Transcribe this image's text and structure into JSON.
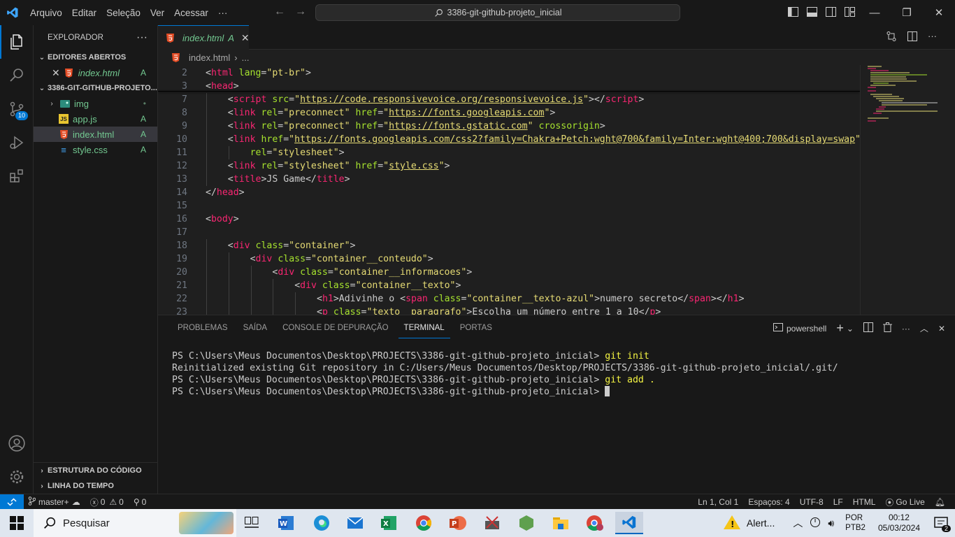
{
  "titlebar": {
    "menu": [
      "Arquivo",
      "Editar",
      "Seleção",
      "Ver",
      "Acessar",
      "···"
    ],
    "search_text": "3386-git-github-projeto_inicial"
  },
  "sidebar": {
    "title": "EXPLORADOR",
    "open_editors_label": "EDITORES ABERTOS",
    "open_editors": [
      {
        "name": "index.html",
        "status": "A"
      }
    ],
    "project_label": "3386-GIT-GITHUB-PROJETO...",
    "files": [
      {
        "name": "img",
        "status": "•",
        "type": "folder"
      },
      {
        "name": "app.js",
        "status": "A",
        "type": "js"
      },
      {
        "name": "index.html",
        "status": "A",
        "type": "html"
      },
      {
        "name": "style.css",
        "status": "A",
        "type": "css"
      }
    ],
    "outline_label": "ESTRUTURA DO CÓDIGO",
    "timeline_label": "LINHA DO TEMPO",
    "source_control_badge": "10"
  },
  "editor": {
    "tab_label": "index.html",
    "tab_status": "A",
    "breadcrumb_file": "index.html",
    "breadcrumb_more": "...",
    "lines": [
      {
        "n": "2",
        "indent": 0,
        "tokens": [
          [
            "br",
            "<"
          ],
          [
            "tag",
            "html"
          ],
          [
            "attr",
            " lang"
          ],
          [
            "br",
            "="
          ],
          [
            "str",
            "\"pt-br\""
          ],
          [
            "br",
            ">"
          ]
        ]
      },
      {
        "n": "3",
        "indent": 0,
        "tokens": [
          [
            "br",
            "<"
          ],
          [
            "tag",
            "head"
          ],
          [
            "br",
            ">"
          ]
        ]
      },
      {
        "n": "7",
        "indent": 1,
        "tokens": [
          [
            "br",
            "<"
          ],
          [
            "tag",
            "script"
          ],
          [
            "attr",
            " src"
          ],
          [
            "br",
            "="
          ],
          [
            "str",
            "\""
          ],
          [
            "url",
            "https://code.responsivevoice.org/responsivevoice.js"
          ],
          [
            "str",
            "\""
          ],
          [
            "br",
            "></"
          ],
          [
            "tag",
            "script"
          ],
          [
            "br",
            ">"
          ]
        ]
      },
      {
        "n": "8",
        "indent": 1,
        "tokens": [
          [
            "br",
            "<"
          ],
          [
            "tag",
            "link"
          ],
          [
            "attr",
            " rel"
          ],
          [
            "br",
            "="
          ],
          [
            "str",
            "\"preconnect\""
          ],
          [
            "attr",
            " href"
          ],
          [
            "br",
            "="
          ],
          [
            "str",
            "\""
          ],
          [
            "url",
            "https://fonts.googleapis.com"
          ],
          [
            "str",
            "\""
          ],
          [
            "br",
            ">"
          ]
        ]
      },
      {
        "n": "9",
        "indent": 1,
        "tokens": [
          [
            "br",
            "<"
          ],
          [
            "tag",
            "link"
          ],
          [
            "attr",
            " rel"
          ],
          [
            "br",
            "="
          ],
          [
            "str",
            "\"preconnect\""
          ],
          [
            "attr",
            " href"
          ],
          [
            "br",
            "="
          ],
          [
            "str",
            "\""
          ],
          [
            "url",
            "https://fonts.gstatic.com"
          ],
          [
            "str",
            "\""
          ],
          [
            "attr",
            " crossorigin"
          ],
          [
            "br",
            ">"
          ]
        ]
      },
      {
        "n": "10",
        "indent": 1,
        "tokens": [
          [
            "br",
            "<"
          ],
          [
            "tag",
            "link"
          ],
          [
            "attr",
            " href"
          ],
          [
            "br",
            "="
          ],
          [
            "str",
            "\""
          ],
          [
            "url",
            "https://fonts.googleapis.com/css2?family=Chakra+Petch:wght@700&family=Inter:wght@400;700&display=swap"
          ],
          [
            "str",
            "\""
          ]
        ]
      },
      {
        "n": "11",
        "indent": 2,
        "tokens": [
          [
            "attr",
            "rel"
          ],
          [
            "br",
            "="
          ],
          [
            "str",
            "\"stylesheet\""
          ],
          [
            "br",
            ">"
          ]
        ]
      },
      {
        "n": "12",
        "indent": 1,
        "tokens": [
          [
            "br",
            "<"
          ],
          [
            "tag",
            "link"
          ],
          [
            "attr",
            " rel"
          ],
          [
            "br",
            "="
          ],
          [
            "str",
            "\"stylesheet\""
          ],
          [
            "attr",
            " href"
          ],
          [
            "br",
            "="
          ],
          [
            "str",
            "\""
          ],
          [
            "url",
            "style.css"
          ],
          [
            "str",
            "\""
          ],
          [
            "br",
            ">"
          ]
        ]
      },
      {
        "n": "13",
        "indent": 1,
        "tokens": [
          [
            "br",
            "<"
          ],
          [
            "tag",
            "title"
          ],
          [
            "br",
            ">"
          ],
          [
            "txt",
            "JS Game"
          ],
          [
            "br",
            "</"
          ],
          [
            "tag",
            "title"
          ],
          [
            "br",
            ">"
          ]
        ]
      },
      {
        "n": "14",
        "indent": 0,
        "tokens": [
          [
            "br",
            "</"
          ],
          [
            "tag",
            "head"
          ],
          [
            "br",
            ">"
          ]
        ]
      },
      {
        "n": "15",
        "indent": 0,
        "tokens": []
      },
      {
        "n": "16",
        "indent": 0,
        "tokens": [
          [
            "br",
            "<"
          ],
          [
            "tag",
            "body"
          ],
          [
            "br",
            ">"
          ]
        ]
      },
      {
        "n": "17",
        "indent": 0,
        "tokens": []
      },
      {
        "n": "18",
        "indent": 1,
        "tokens": [
          [
            "br",
            "<"
          ],
          [
            "tag",
            "div"
          ],
          [
            "attr",
            " class"
          ],
          [
            "br",
            "="
          ],
          [
            "str",
            "\"container\""
          ],
          [
            "br",
            ">"
          ]
        ]
      },
      {
        "n": "19",
        "indent": 2,
        "tokens": [
          [
            "br",
            "<"
          ],
          [
            "tag",
            "div"
          ],
          [
            "attr",
            " class"
          ],
          [
            "br",
            "="
          ],
          [
            "str",
            "\"container__conteudo\""
          ],
          [
            "br",
            ">"
          ]
        ]
      },
      {
        "n": "20",
        "indent": 3,
        "tokens": [
          [
            "br",
            "<"
          ],
          [
            "tag",
            "div"
          ],
          [
            "attr",
            " class"
          ],
          [
            "br",
            "="
          ],
          [
            "str",
            "\"container__informacoes\""
          ],
          [
            "br",
            ">"
          ]
        ]
      },
      {
        "n": "21",
        "indent": 4,
        "tokens": [
          [
            "br",
            "<"
          ],
          [
            "tag",
            "div"
          ],
          [
            "attr",
            " class"
          ],
          [
            "br",
            "="
          ],
          [
            "str",
            "\"container__texto\""
          ],
          [
            "br",
            ">"
          ]
        ]
      },
      {
        "n": "22",
        "indent": 5,
        "tokens": [
          [
            "br",
            "<"
          ],
          [
            "tag",
            "h1"
          ],
          [
            "br",
            ">"
          ],
          [
            "txt",
            "Adivinhe o "
          ],
          [
            "br",
            "<"
          ],
          [
            "tag",
            "span"
          ],
          [
            "attr",
            " class"
          ],
          [
            "br",
            "="
          ],
          [
            "str",
            "\"container__texto-azul\""
          ],
          [
            "br",
            ">"
          ],
          [
            "txt",
            "numero secreto"
          ],
          [
            "br",
            "</"
          ],
          [
            "tag",
            "span"
          ],
          [
            "br",
            "></"
          ],
          [
            "tag",
            "h1"
          ],
          [
            "br",
            ">"
          ]
        ]
      },
      {
        "n": "23",
        "indent": 5,
        "tokens": [
          [
            "br",
            "<"
          ],
          [
            "tag",
            "p"
          ],
          [
            "attr",
            " class"
          ],
          [
            "br",
            "="
          ],
          [
            "str",
            "\"texto__paragrafo\""
          ],
          [
            "br",
            ">"
          ],
          [
            "txt",
            "Escolha um número entre 1 a 10"
          ],
          [
            "br",
            "</"
          ],
          [
            "tag",
            "p"
          ],
          [
            "br",
            ">"
          ]
        ]
      }
    ]
  },
  "panel": {
    "tabs": [
      "PROBLEMAS",
      "SAÍDA",
      "CONSOLE DE DEPURAÇÃO",
      "TERMINAL",
      "PORTAS"
    ],
    "active_tab": "TERMINAL",
    "shell": "powershell",
    "terminal_lines": [
      {
        "prompt": "PS C:\\Users\\Meus Documentos\\Desktop\\PROJECTS\\3386-git-github-projeto_inicial> ",
        "cmd": "git init"
      },
      {
        "prompt": "Reinitialized existing Git repository in C:/Users/Meus Documentos/Desktop/PROJECTS/3386-git-github-projeto_inicial/.git/",
        "cmd": ""
      },
      {
        "prompt": "PS C:\\Users\\Meus Documentos\\Desktop\\PROJECTS\\3386-git-github-projeto_inicial> ",
        "cmd": "git add ."
      },
      {
        "prompt": "PS C:\\Users\\Meus Documentos\\Desktop\\PROJECTS\\3386-git-github-projeto_inicial> ",
        "cmd": ""
      }
    ]
  },
  "statusbar": {
    "branch": "master+",
    "errors": "0",
    "warnings": "0",
    "ports": "0",
    "position": "Ln 1, Col 1",
    "spaces": "Espaços: 4",
    "encoding": "UTF-8",
    "eol": "LF",
    "language": "HTML",
    "golive": "Go Live"
  },
  "taskbar": {
    "search_placeholder": "Pesquisar",
    "alert_text": "Alert...",
    "lang_top": "POR",
    "lang_bottom": "PTB2",
    "time": "00:12",
    "date": "05/03/2024",
    "notifications": "2"
  },
  "colors": {
    "accent": "#0078d4",
    "git_added": "#73c991",
    "tag": "#f92672",
    "attr": "#a6e22e",
    "string": "#e6db74"
  }
}
